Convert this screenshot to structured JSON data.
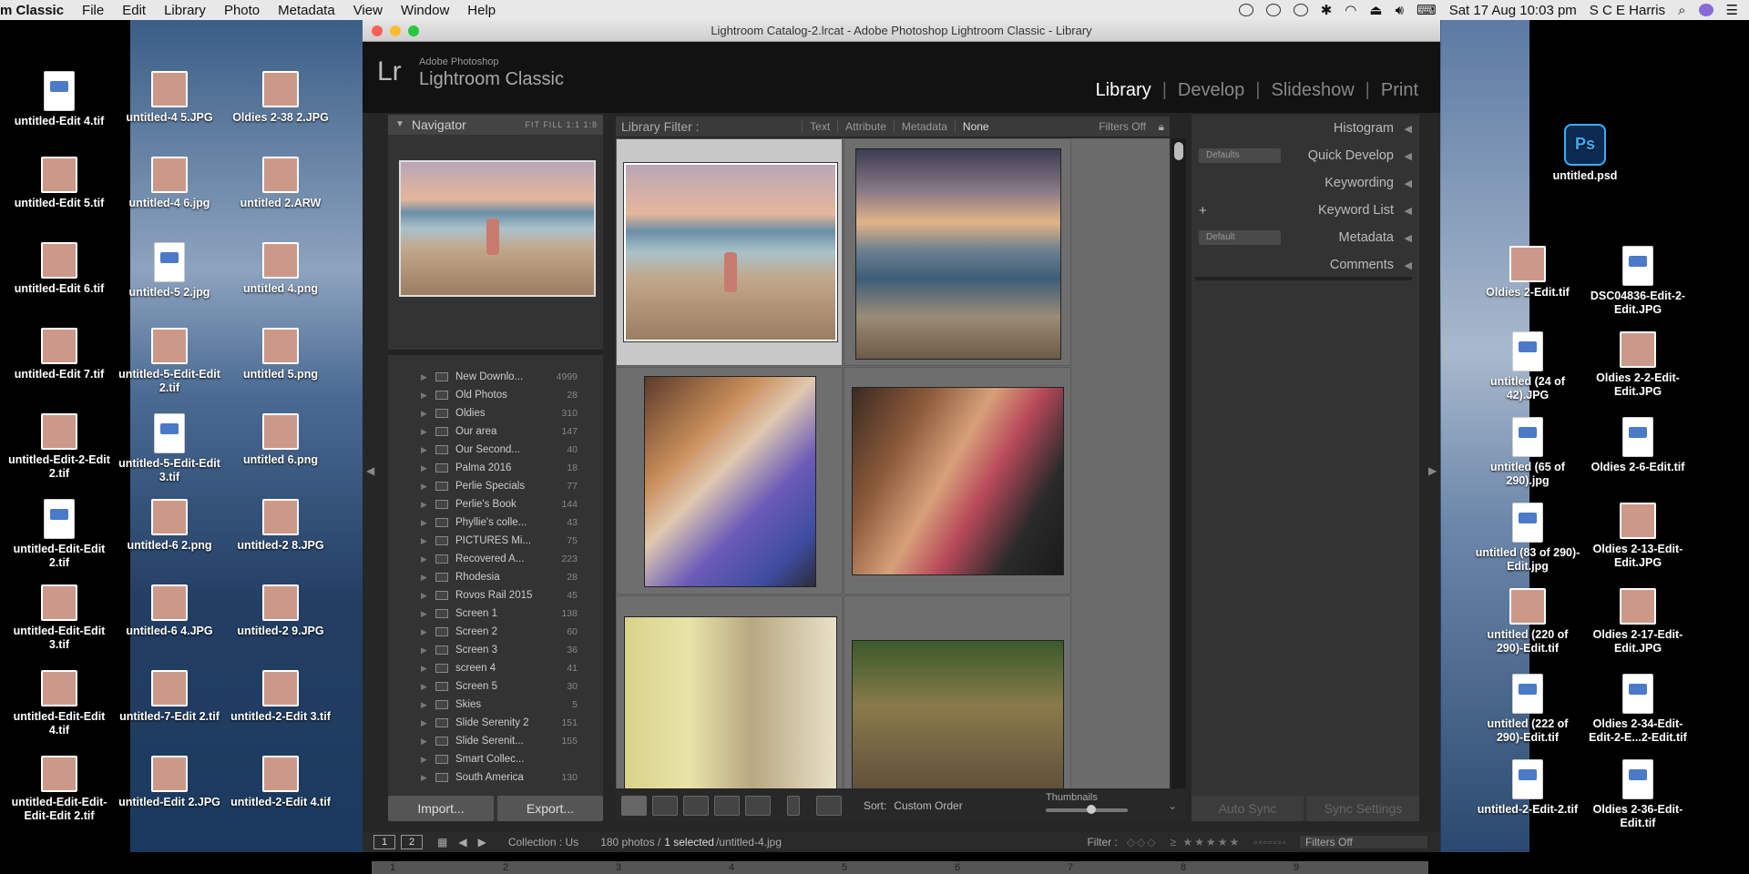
{
  "menubar": {
    "app_name": "m Classic",
    "menus": [
      "File",
      "Edit",
      "Library",
      "Photo",
      "Metadata",
      "View",
      "Window",
      "Help"
    ],
    "datetime": "Sat 17 Aug  10:03 pm",
    "user": "S C E Harris"
  },
  "desktop_icons_left": [
    {
      "label": "untitled-Edit 4.tif",
      "kind": "doc"
    },
    {
      "label": "untitled-4 5.JPG",
      "kind": "photo"
    },
    {
      "label": "Oldies 2-38 2.JPG",
      "kind": "photo"
    },
    {
      "label": "untitled-Edit 5.tif",
      "kind": "photo"
    },
    {
      "label": "untitled-4 6.jpg",
      "kind": "photo"
    },
    {
      "label": "untitled 2.ARW",
      "kind": "photo"
    },
    {
      "label": "untitled-Edit 6.tif",
      "kind": "photo"
    },
    {
      "label": "untitled-5 2.jpg",
      "kind": "doc"
    },
    {
      "label": "untitled 4.png",
      "kind": "photo"
    },
    {
      "label": "untitled-Edit 7.tif",
      "kind": "photo"
    },
    {
      "label": "untitled-5-Edit-Edit 2.tif",
      "kind": "photo"
    },
    {
      "label": "untitled 5.png",
      "kind": "photo"
    },
    {
      "label": "untitled-Edit-2-Edit 2.tif",
      "kind": "photo"
    },
    {
      "label": "untitled-5-Edit-Edit 3.tif",
      "kind": "doc"
    },
    {
      "label": "untitled 6.png",
      "kind": "photo"
    },
    {
      "label": "untitled-Edit-Edit 2.tif",
      "kind": "doc"
    },
    {
      "label": "untitled-6 2.png",
      "kind": "photo"
    },
    {
      "label": "untitled-2 8.JPG",
      "kind": "photo"
    },
    {
      "label": "untitled-Edit-Edit 3.tif",
      "kind": "photo"
    },
    {
      "label": "untitled-6 4.JPG",
      "kind": "photo"
    },
    {
      "label": "untitled-2 9.JPG",
      "kind": "photo"
    },
    {
      "label": "untitled-Edit-Edit 4.tif",
      "kind": "photo"
    },
    {
      "label": "untitled-7-Edit 2.tif",
      "kind": "photo"
    },
    {
      "label": "untitled-2-Edit 3.tif",
      "kind": "photo"
    },
    {
      "label": "untitled-Edit-Edit-Edit-Edit 2.tif",
      "kind": "photo"
    },
    {
      "label": "untitled-Edit 2.JPG",
      "kind": "photo"
    },
    {
      "label": "untitled-2-Edit 4.tif",
      "kind": "photo"
    }
  ],
  "desktop_icons_right": [
    {
      "label": "untitled.psd",
      "kind": "psd"
    },
    {
      "label": "Oldies 2-Edit.tif",
      "kind": "photo"
    },
    {
      "label": "DSC04836-Edit-2-Edit.JPG",
      "kind": "doc"
    },
    {
      "label": "untitled (24 of 42).JPG",
      "kind": "doc"
    },
    {
      "label": "Oldies 2-2-Edit-Edit.JPG",
      "kind": "photo"
    },
    {
      "label": "untitled (65 of 290).jpg",
      "kind": "doc"
    },
    {
      "label": "Oldies 2-6-Edit.tif",
      "kind": "doc"
    },
    {
      "label": "untitled (83 of 290)-Edit.jpg",
      "kind": "doc"
    },
    {
      "label": "Oldies 2-13-Edit-Edit.JPG",
      "kind": "photo"
    },
    {
      "label": "untitled (220 of 290)-Edit.tif",
      "kind": "photo"
    },
    {
      "label": "Oldies 2-17-Edit-Edit.JPG",
      "kind": "photo"
    },
    {
      "label": "untitled (222 of 290)-Edit.tif",
      "kind": "doc"
    },
    {
      "label": "Oldies 2-34-Edit-Edit-2-E...2-Edit.tif",
      "kind": "doc"
    },
    {
      "label": "untitled-2-Edit-2.tif",
      "kind": "doc"
    },
    {
      "label": "Oldies 2-36-Edit-Edit.tif",
      "kind": "doc"
    }
  ],
  "window": {
    "title": "Lightroom Catalog-2.lrcat - Adobe Photoshop Lightroom Classic - Library"
  },
  "lr": {
    "logo": "Lr",
    "brand_small": "Adobe Photoshop",
    "brand_big": "Lightroom Classic",
    "modules": [
      "Library",
      "Develop",
      "Slideshow",
      "Print"
    ],
    "active_module": "Library"
  },
  "navigator": {
    "title": "Navigator",
    "options": "FIT   FILL   1:1   1:8"
  },
  "folders": [
    {
      "name": "New Downlo...",
      "count": "4999"
    },
    {
      "name": "Old Photos",
      "count": "28"
    },
    {
      "name": "Oldies",
      "count": "310"
    },
    {
      "name": "Our area",
      "count": "147"
    },
    {
      "name": "Our Second...",
      "count": "40"
    },
    {
      "name": "Palma 2016",
      "count": "18"
    },
    {
      "name": "Perlie Specials",
      "count": "77"
    },
    {
      "name": "Perlie's Book",
      "count": "144"
    },
    {
      "name": "Phyllie's colle...",
      "count": "43"
    },
    {
      "name": "PICTURES Mi...",
      "count": "75"
    },
    {
      "name": "Recovered A...",
      "count": "223"
    },
    {
      "name": "Rhodesia",
      "count": "28"
    },
    {
      "name": "Rovos Rail 2015",
      "count": "45"
    },
    {
      "name": "Screen 1",
      "count": "138"
    },
    {
      "name": "Screen 2",
      "count": "60"
    },
    {
      "name": "Screen 3",
      "count": "36"
    },
    {
      "name": "screen 4",
      "count": "41"
    },
    {
      "name": "Screen 5",
      "count": "30"
    },
    {
      "name": "Skies",
      "count": "5"
    },
    {
      "name": "Slide Serenity 2",
      "count": "151"
    },
    {
      "name": "Slide Serenit...",
      "count": "155"
    },
    {
      "name": "Smart Collec...",
      "count": ""
    },
    {
      "name": "South America",
      "count": "130"
    }
  ],
  "left_buttons": {
    "import": "Import...",
    "export": "Export..."
  },
  "filter": {
    "label": "Library Filter :",
    "options": [
      "Text",
      "Attribute",
      "Metadata",
      "None"
    ],
    "status": "Filters Off"
  },
  "toolbar": {
    "sort_label": "Sort:",
    "sort_value": "Custom Order",
    "thumbnails_label": "Thumbnails",
    "thumbnail_size": 0.55
  },
  "right_panel": {
    "histogram": "Histogram",
    "quick_develop": "Quick Develop",
    "quick_develop_preset": "Defaults",
    "keywording": "Keywording",
    "keyword_list": "Keyword List",
    "metadata": "Metadata",
    "metadata_preset": "Default",
    "comments": "Comments",
    "auto_sync": "Auto Sync",
    "sync_settings": "Sync Settings"
  },
  "filmstrip": {
    "page1": "1",
    "page2": "2",
    "collection": "Collection : Us",
    "count": "180 photos /",
    "selected": "1 selected",
    "file": "/untitled-4.jpg",
    "filter_label": "Filter :",
    "filter_status": "Filters Off",
    "strip_numbers": [
      "1",
      "2",
      "3",
      "4",
      "5",
      "6",
      "7",
      "8",
      "9"
    ]
  }
}
